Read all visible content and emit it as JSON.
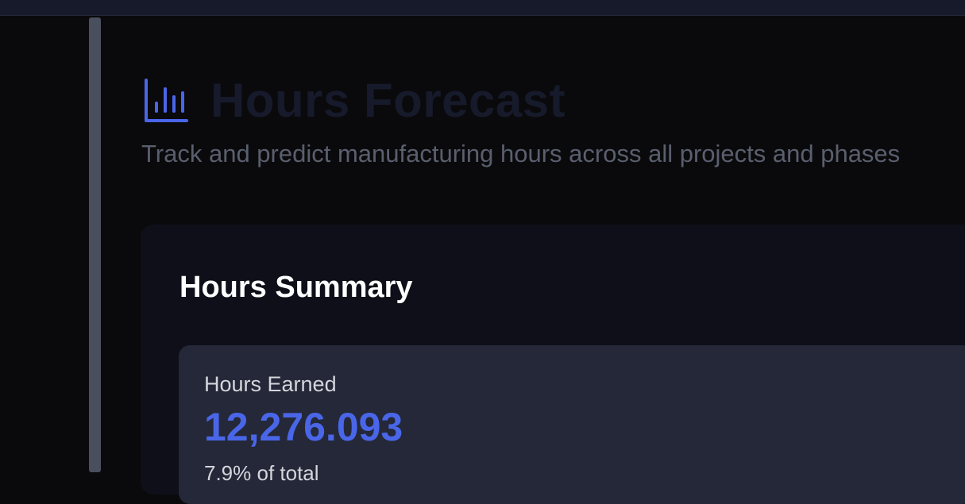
{
  "header": {
    "title": "Hours Forecast",
    "subtitle": "Track and predict manufacturing hours across all projects and phases",
    "icon": "bar-chart-icon"
  },
  "summary": {
    "title": "Hours Summary",
    "stats": [
      {
        "label": "Hours Earned",
        "value": "12,276.093",
        "sub": "7.9% of total"
      }
    ]
  },
  "colors": {
    "accent": "#4a66e8",
    "background": "#0a0a0c",
    "card": "#0e0f19",
    "stat_card": "#242838"
  }
}
